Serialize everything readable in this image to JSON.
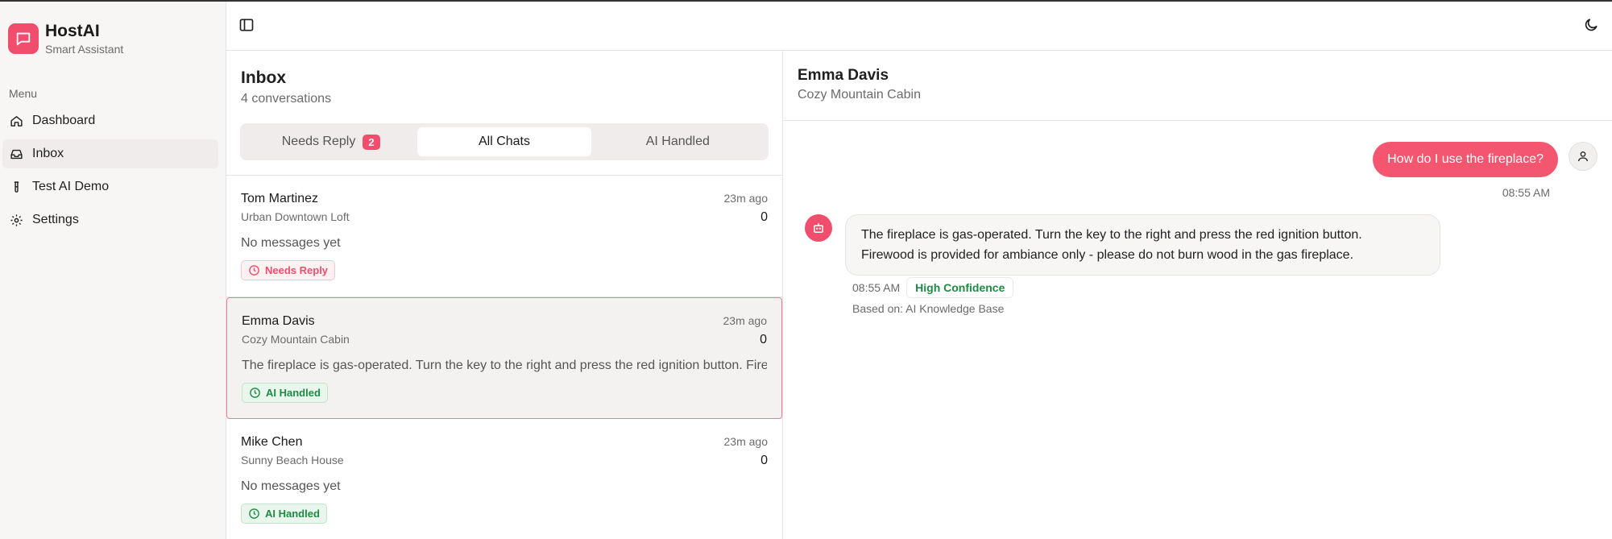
{
  "brand": {
    "name": "HostAI",
    "subtitle": "Smart Assistant",
    "color": "#f04e6c"
  },
  "sidebar": {
    "menu_label": "Menu",
    "items": [
      {
        "label": "Dashboard",
        "icon": "home-icon",
        "active": false
      },
      {
        "label": "Inbox",
        "icon": "inbox-icon",
        "active": true
      },
      {
        "label": "Test AI Demo",
        "icon": "test-tube-icon",
        "active": false
      },
      {
        "label": "Settings",
        "icon": "gear-icon",
        "active": false
      }
    ]
  },
  "topbar": {
    "left_icon": "sidebar-toggle-icon",
    "right_icon": "moon-icon"
  },
  "inbox": {
    "title": "Inbox",
    "count": "4 conversations",
    "tabs": [
      {
        "label": "Needs Reply",
        "badge": "2",
        "active": false
      },
      {
        "label": "All Chats",
        "active": true
      },
      {
        "label": "AI Handled",
        "active": false
      }
    ],
    "conversations": [
      {
        "name": "Tom Martinez",
        "property": "Urban Downtown Loft",
        "time": "23m ago",
        "count": "0",
        "message": "No messages yet",
        "status": "Needs Reply",
        "status_type": "needs",
        "selected": false
      },
      {
        "name": "Emma Davis",
        "property": "Cozy Mountain Cabin",
        "time": "23m ago",
        "count": "0",
        "message": "The fireplace is gas-operated. Turn the key to the right and press the red ignition button. Firewood is provided for ambiance only - please do not burn wood in the gas fireplace.",
        "status": "AI Handled",
        "status_type": "ai",
        "selected": true
      },
      {
        "name": "Mike Chen",
        "property": "Sunny Beach House",
        "time": "23m ago",
        "count": "0",
        "message": "No messages yet",
        "status": "AI Handled",
        "status_type": "ai",
        "selected": false
      }
    ]
  },
  "chat": {
    "guest_name": "Emma Davis",
    "property": "Cozy Mountain Cabin",
    "guest_message": "How do I use the fireplace?",
    "guest_time": "08:55 AM",
    "ai_message_line1": "The fireplace is gas-operated. Turn the key to the right and press the red ignition button.",
    "ai_message_line2": "Firewood is provided for ambiance only - please do not burn wood in the gas fireplace.",
    "ai_time": "08:55 AM",
    "confidence": "High Confidence",
    "source": "Based on: AI Knowledge Base"
  },
  "colors": {
    "accent": "#f04e6c",
    "success": "#1f8a45"
  }
}
